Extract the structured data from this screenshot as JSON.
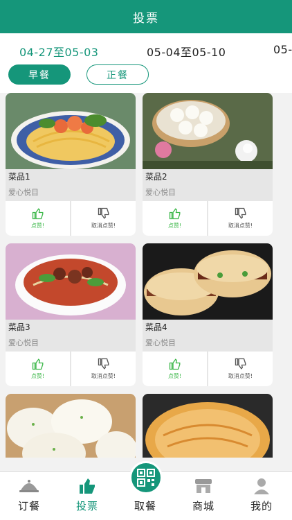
{
  "header": {
    "title": "投票"
  },
  "weeks": [
    {
      "label": "04-27至05-03",
      "active": true
    },
    {
      "label": "05-04至05-10",
      "active": false
    },
    {
      "label": "05-",
      "active": false
    }
  ],
  "meals": [
    {
      "label": "早餐",
      "active": true
    },
    {
      "label": "正餐",
      "active": false
    }
  ],
  "dishes": [
    {
      "name": "菜品1",
      "desc": "爱心悦目",
      "like": "点赞!",
      "unlike": "取消点赞!",
      "image": "noodles-shrimp"
    },
    {
      "name": "菜品2",
      "desc": "爱心悦目",
      "like": "点赞!",
      "unlike": "取消点赞!",
      "image": "steamed-buns"
    },
    {
      "name": "菜品3",
      "desc": "爱心悦目",
      "like": "点赞!",
      "unlike": "取消点赞!",
      "image": "beef-noodles"
    },
    {
      "name": "菜品4",
      "desc": "爱心悦目",
      "like": "点赞!",
      "unlike": "取消点赞!",
      "image": "roujiamo"
    },
    {
      "name": "",
      "desc": "",
      "like": "",
      "unlike": "",
      "image": "mantou"
    },
    {
      "name": "",
      "desc": "",
      "like": "",
      "unlike": "",
      "image": "pancake"
    }
  ],
  "tabs": [
    {
      "label": "订餐",
      "icon": "cloche-icon",
      "active": false
    },
    {
      "label": "投票",
      "icon": "thumbs-up-icon",
      "active": true
    },
    {
      "label": "取餐",
      "icon": "qr-code-icon",
      "active": false
    },
    {
      "label": "商城",
      "icon": "shop-icon",
      "active": false
    },
    {
      "label": "我的",
      "icon": "user-icon",
      "active": false
    }
  ],
  "colors": {
    "brand": "#15967a",
    "like": "#3db84a"
  }
}
